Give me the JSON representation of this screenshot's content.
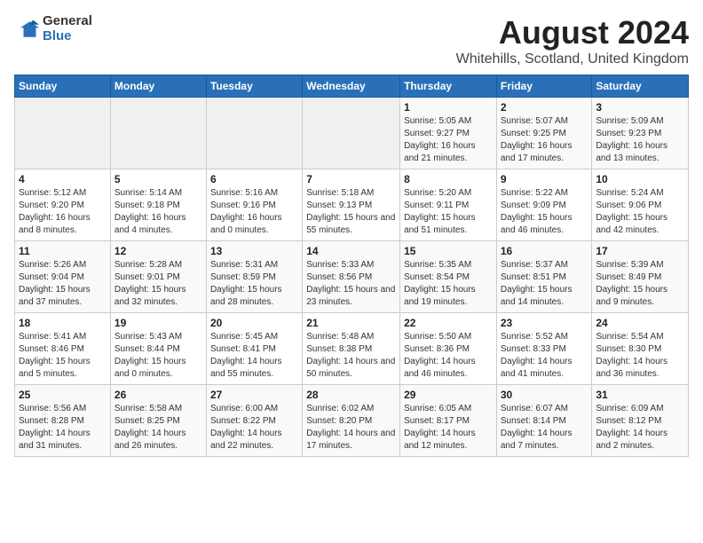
{
  "logo": {
    "general": "General",
    "blue": "Blue"
  },
  "title": "August 2024",
  "subtitle": "Whitehills, Scotland, United Kingdom",
  "headers": [
    "Sunday",
    "Monday",
    "Tuesday",
    "Wednesday",
    "Thursday",
    "Friday",
    "Saturday"
  ],
  "weeks": [
    [
      {
        "day": "",
        "info": ""
      },
      {
        "day": "",
        "info": ""
      },
      {
        "day": "",
        "info": ""
      },
      {
        "day": "",
        "info": ""
      },
      {
        "day": "1",
        "info": "Sunrise: 5:05 AM\nSunset: 9:27 PM\nDaylight: 16 hours and 21 minutes."
      },
      {
        "day": "2",
        "info": "Sunrise: 5:07 AM\nSunset: 9:25 PM\nDaylight: 16 hours and 17 minutes."
      },
      {
        "day": "3",
        "info": "Sunrise: 5:09 AM\nSunset: 9:23 PM\nDaylight: 16 hours and 13 minutes."
      }
    ],
    [
      {
        "day": "4",
        "info": "Sunrise: 5:12 AM\nSunset: 9:20 PM\nDaylight: 16 hours and 8 minutes."
      },
      {
        "day": "5",
        "info": "Sunrise: 5:14 AM\nSunset: 9:18 PM\nDaylight: 16 hours and 4 minutes."
      },
      {
        "day": "6",
        "info": "Sunrise: 5:16 AM\nSunset: 9:16 PM\nDaylight: 16 hours and 0 minutes."
      },
      {
        "day": "7",
        "info": "Sunrise: 5:18 AM\nSunset: 9:13 PM\nDaylight: 15 hours and 55 minutes."
      },
      {
        "day": "8",
        "info": "Sunrise: 5:20 AM\nSunset: 9:11 PM\nDaylight: 15 hours and 51 minutes."
      },
      {
        "day": "9",
        "info": "Sunrise: 5:22 AM\nSunset: 9:09 PM\nDaylight: 15 hours and 46 minutes."
      },
      {
        "day": "10",
        "info": "Sunrise: 5:24 AM\nSunset: 9:06 PM\nDaylight: 15 hours and 42 minutes."
      }
    ],
    [
      {
        "day": "11",
        "info": "Sunrise: 5:26 AM\nSunset: 9:04 PM\nDaylight: 15 hours and 37 minutes."
      },
      {
        "day": "12",
        "info": "Sunrise: 5:28 AM\nSunset: 9:01 PM\nDaylight: 15 hours and 32 minutes."
      },
      {
        "day": "13",
        "info": "Sunrise: 5:31 AM\nSunset: 8:59 PM\nDaylight: 15 hours and 28 minutes."
      },
      {
        "day": "14",
        "info": "Sunrise: 5:33 AM\nSunset: 8:56 PM\nDaylight: 15 hours and 23 minutes."
      },
      {
        "day": "15",
        "info": "Sunrise: 5:35 AM\nSunset: 8:54 PM\nDaylight: 15 hours and 19 minutes."
      },
      {
        "day": "16",
        "info": "Sunrise: 5:37 AM\nSunset: 8:51 PM\nDaylight: 15 hours and 14 minutes."
      },
      {
        "day": "17",
        "info": "Sunrise: 5:39 AM\nSunset: 8:49 PM\nDaylight: 15 hours and 9 minutes."
      }
    ],
    [
      {
        "day": "18",
        "info": "Sunrise: 5:41 AM\nSunset: 8:46 PM\nDaylight: 15 hours and 5 minutes."
      },
      {
        "day": "19",
        "info": "Sunrise: 5:43 AM\nSunset: 8:44 PM\nDaylight: 15 hours and 0 minutes."
      },
      {
        "day": "20",
        "info": "Sunrise: 5:45 AM\nSunset: 8:41 PM\nDaylight: 14 hours and 55 minutes."
      },
      {
        "day": "21",
        "info": "Sunrise: 5:48 AM\nSunset: 8:38 PM\nDaylight: 14 hours and 50 minutes."
      },
      {
        "day": "22",
        "info": "Sunrise: 5:50 AM\nSunset: 8:36 PM\nDaylight: 14 hours and 46 minutes."
      },
      {
        "day": "23",
        "info": "Sunrise: 5:52 AM\nSunset: 8:33 PM\nDaylight: 14 hours and 41 minutes."
      },
      {
        "day": "24",
        "info": "Sunrise: 5:54 AM\nSunset: 8:30 PM\nDaylight: 14 hours and 36 minutes."
      }
    ],
    [
      {
        "day": "25",
        "info": "Sunrise: 5:56 AM\nSunset: 8:28 PM\nDaylight: 14 hours and 31 minutes."
      },
      {
        "day": "26",
        "info": "Sunrise: 5:58 AM\nSunset: 8:25 PM\nDaylight: 14 hours and 26 minutes."
      },
      {
        "day": "27",
        "info": "Sunrise: 6:00 AM\nSunset: 8:22 PM\nDaylight: 14 hours and 22 minutes."
      },
      {
        "day": "28",
        "info": "Sunrise: 6:02 AM\nSunset: 8:20 PM\nDaylight: 14 hours and 17 minutes."
      },
      {
        "day": "29",
        "info": "Sunrise: 6:05 AM\nSunset: 8:17 PM\nDaylight: 14 hours and 12 minutes."
      },
      {
        "day": "30",
        "info": "Sunrise: 6:07 AM\nSunset: 8:14 PM\nDaylight: 14 hours and 7 minutes."
      },
      {
        "day": "31",
        "info": "Sunrise: 6:09 AM\nSunset: 8:12 PM\nDaylight: 14 hours and 2 minutes."
      }
    ]
  ]
}
